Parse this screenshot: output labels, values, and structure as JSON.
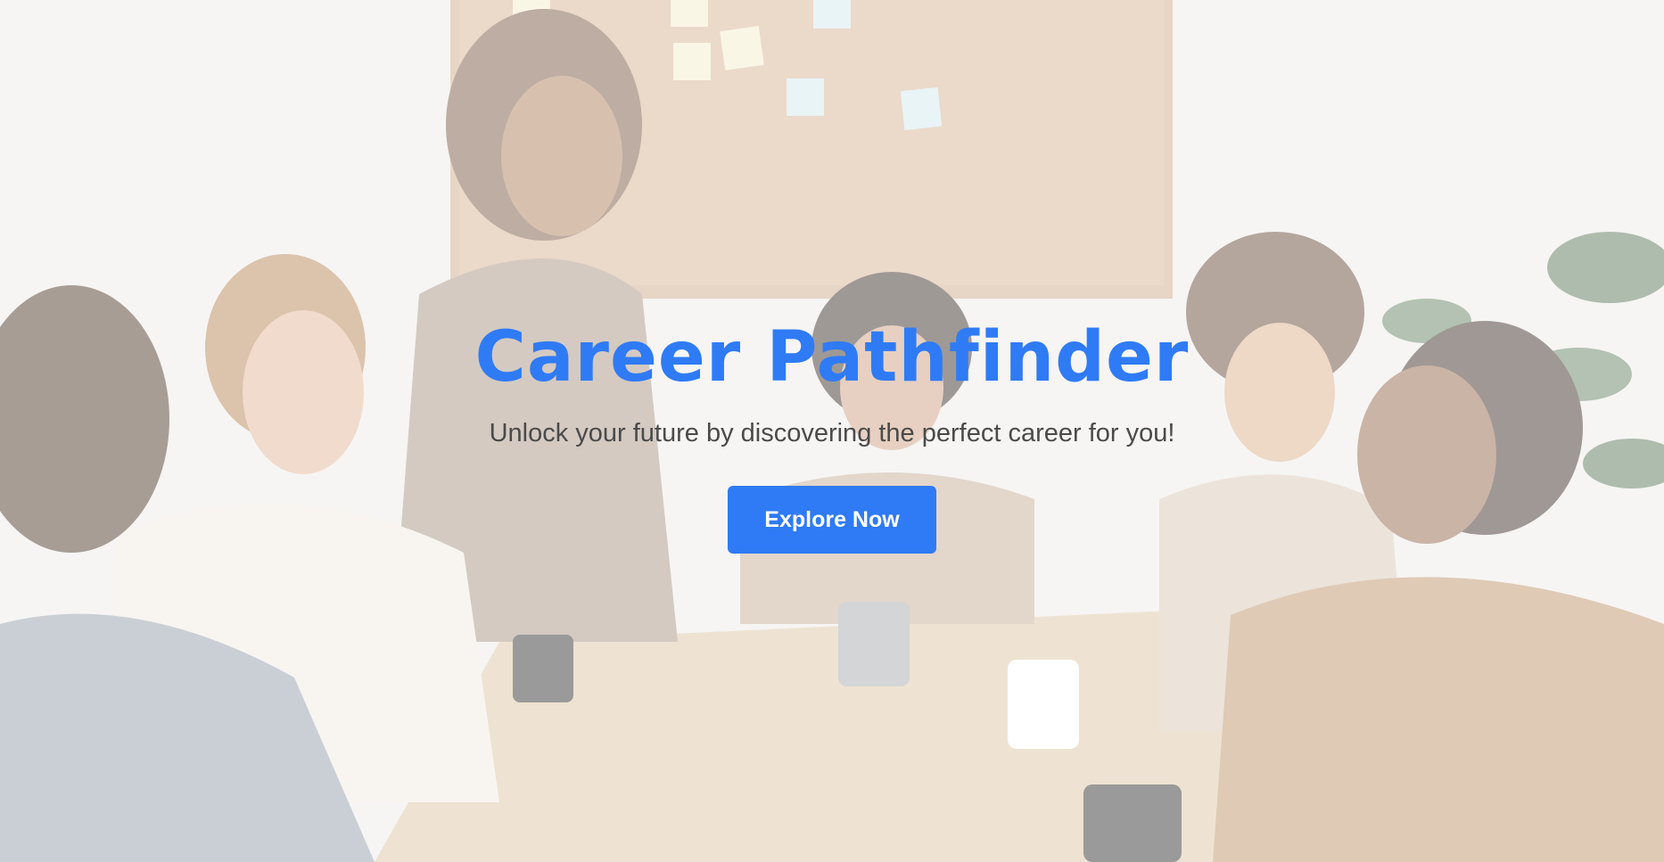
{
  "hero": {
    "title": "Career Pathfinder",
    "subtitle": "Unlock your future by discovering the perfect career for you!",
    "cta_label": "Explore Now"
  },
  "colors": {
    "accent": "#2f7bf5",
    "subtitle_text": "#4a4a4a",
    "button_text": "#ffffff"
  }
}
